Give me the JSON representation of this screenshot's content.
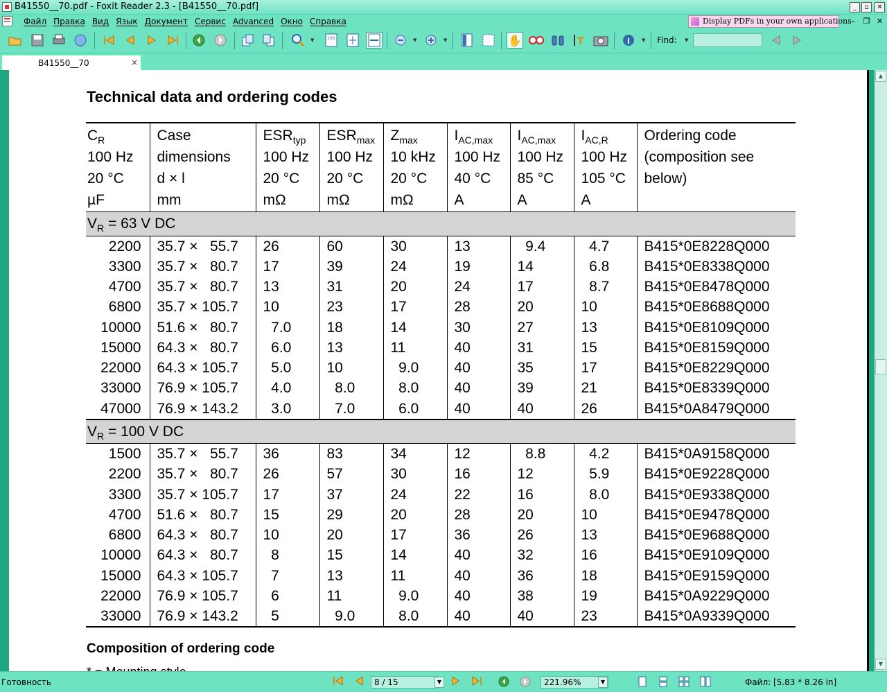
{
  "window": {
    "title": "B41550__70.pdf - Foxit Reader 2.3 - [B41550__70.pdf]",
    "promo": "Display PDFs in your own applications"
  },
  "menu": [
    "Файл",
    "Правка",
    "Вид",
    "Язык",
    "Документ",
    "Сервис",
    "Advanced",
    "Окно",
    "Справка"
  ],
  "toolbar": {
    "find_label": "Find:",
    "find_value": "",
    "icons": [
      "open-icon",
      "save-icon",
      "print-icon",
      "email-icon",
      "first-page-icon",
      "prev-page-icon",
      "next-page-icon",
      "last-page-icon",
      "back-icon",
      "forward-icon",
      "rotate-left-icon",
      "rotate-right-icon",
      "zoom-in-icon",
      "actual-size-icon",
      "fit-page-icon",
      "fit-width-icon",
      "zoom-out-icon",
      "zoom-plus-icon",
      "bookmark-icon",
      "select-icon",
      "hand-icon",
      "snapshot-icon",
      "binoculars-icon",
      "text-select-icon",
      "camera-icon",
      "info-icon",
      "find-prev-icon",
      "find-next-icon"
    ]
  },
  "tab": {
    "label": "B41550__70",
    "close": "×"
  },
  "document": {
    "heading": "Technical data and ordering codes",
    "headers": [
      [
        "C",
        "R",
        "100 Hz",
        "20 °C",
        "µF"
      ],
      [
        "Case",
        "",
        "dimensions",
        "d × l",
        "mm"
      ],
      [
        "ESR",
        "typ",
        "100 Hz",
        "20 °C",
        "mΩ"
      ],
      [
        "ESR",
        "max",
        "100 Hz",
        "20 °C",
        "mΩ"
      ],
      [
        "Z",
        "max",
        "10 kHz",
        "20 °C",
        "mΩ"
      ],
      [
        "I",
        "AC,max",
        "100 Hz",
        "40 °C",
        "A"
      ],
      [
        "I",
        "AC,max",
        "100 Hz",
        "85 °C",
        "A"
      ],
      [
        "I",
        "AC,R",
        "100 Hz",
        "105 °C",
        "A"
      ],
      [
        "Ordering code",
        "",
        "(composition see",
        "below)",
        ""
      ]
    ],
    "groups": [
      {
        "label_pre": "V",
        "label_sub": "R",
        "label_post": " = 63 V DC",
        "rows": [
          [
            "2200",
            "35.7 ×   55.7",
            "26",
            "60",
            "30",
            "13",
            "  9.4",
            "  4.7",
            "B415*0E8228Q000"
          ],
          [
            "3300",
            "35.7 ×   80.7",
            "17",
            "39",
            "24",
            "19",
            "14",
            "  6.8",
            "B415*0E8338Q000"
          ],
          [
            "4700",
            "35.7 ×   80.7",
            "13",
            "31",
            "20",
            "24",
            "17",
            "  8.7",
            "B415*0E8478Q000"
          ],
          [
            "6800",
            "35.7 × 105.7",
            "10",
            "23",
            "17",
            "28",
            "20",
            "10",
            "B415*0E8688Q000"
          ],
          [
            "10000",
            "51.6 ×   80.7",
            "  7.0",
            "18",
            "14",
            "30",
            "27",
            "13",
            "B415*0E8109Q000"
          ],
          [
            "15000",
            "64.3 ×   80.7",
            "  6.0",
            "13",
            "11",
            "40",
            "31",
            "15",
            "B415*0E8159Q000"
          ],
          [
            "22000",
            "64.3 × 105.7",
            "  5.0",
            "10",
            "  9.0",
            "40",
            "35",
            "17",
            "B415*0E8229Q000"
          ],
          [
            "33000",
            "76.9 × 105.7",
            "  4.0",
            "  8.0",
            "  8.0",
            "40",
            "39",
            "21",
            "B415*0E8339Q000"
          ],
          [
            "47000",
            "76.9 × 143.2",
            "  3.0",
            "  7.0",
            "  6.0",
            "40",
            "40",
            "26",
            "B415*0A8479Q000"
          ]
        ]
      },
      {
        "label_pre": "V",
        "label_sub": "R",
        "label_post": " = 100 V DC",
        "rows": [
          [
            "1500",
            "35.7 ×   55.7",
            "36",
            "83",
            "34",
            "12",
            "  8.8",
            "  4.2",
            "B415*0A9158Q000"
          ],
          [
            "2200",
            "35.7 ×   80.7",
            "26",
            "57",
            "30",
            "16",
            "12",
            "  5.9",
            "B415*0E9228Q000"
          ],
          [
            "3300",
            "35.7 × 105.7",
            "17",
            "37",
            "24",
            "22",
            "16",
            "  8.0",
            "B415*0E9338Q000"
          ],
          [
            "4700",
            "51.6 ×   80.7",
            "15",
            "29",
            "20",
            "28",
            "20",
            "10",
            "B415*0E9478Q000"
          ],
          [
            "6800",
            "64.3 ×   80.7",
            "10",
            "20",
            "17",
            "36",
            "26",
            "13",
            "B415*0E9688Q000"
          ],
          [
            "10000",
            "64.3 ×   80.7",
            "  8",
            "15",
            "14",
            "40",
            "32",
            "16",
            "B415*0E9109Q000"
          ],
          [
            "15000",
            "64.3 × 105.7",
            "  7",
            "13",
            "11",
            "40",
            "36",
            "18",
            "B415*0E9159Q000"
          ],
          [
            "22000",
            "76.9 × 105.7",
            "  6",
            "11",
            "  9.0",
            "40",
            "38",
            "19",
            "B415*0A9229Q000"
          ],
          [
            "33000",
            "76.9 × 143.2",
            "  5",
            "  9.0",
            "  8.0",
            "40",
            "40",
            "23",
            "B415*0A9339Q000"
          ]
        ]
      }
    ],
    "composition_heading": "Composition of ordering code",
    "composition_line": "* =      Mounting style"
  },
  "status": {
    "text": "Готовность",
    "page": "8 / 15",
    "zoom": "221.96%",
    "file_info": "Файл: [5.83 * 8.26 in]"
  },
  "colors": {
    "chrome": "#6ee3c2",
    "doc_bg": "#1fa680",
    "group_row": "#d4d4d4"
  }
}
